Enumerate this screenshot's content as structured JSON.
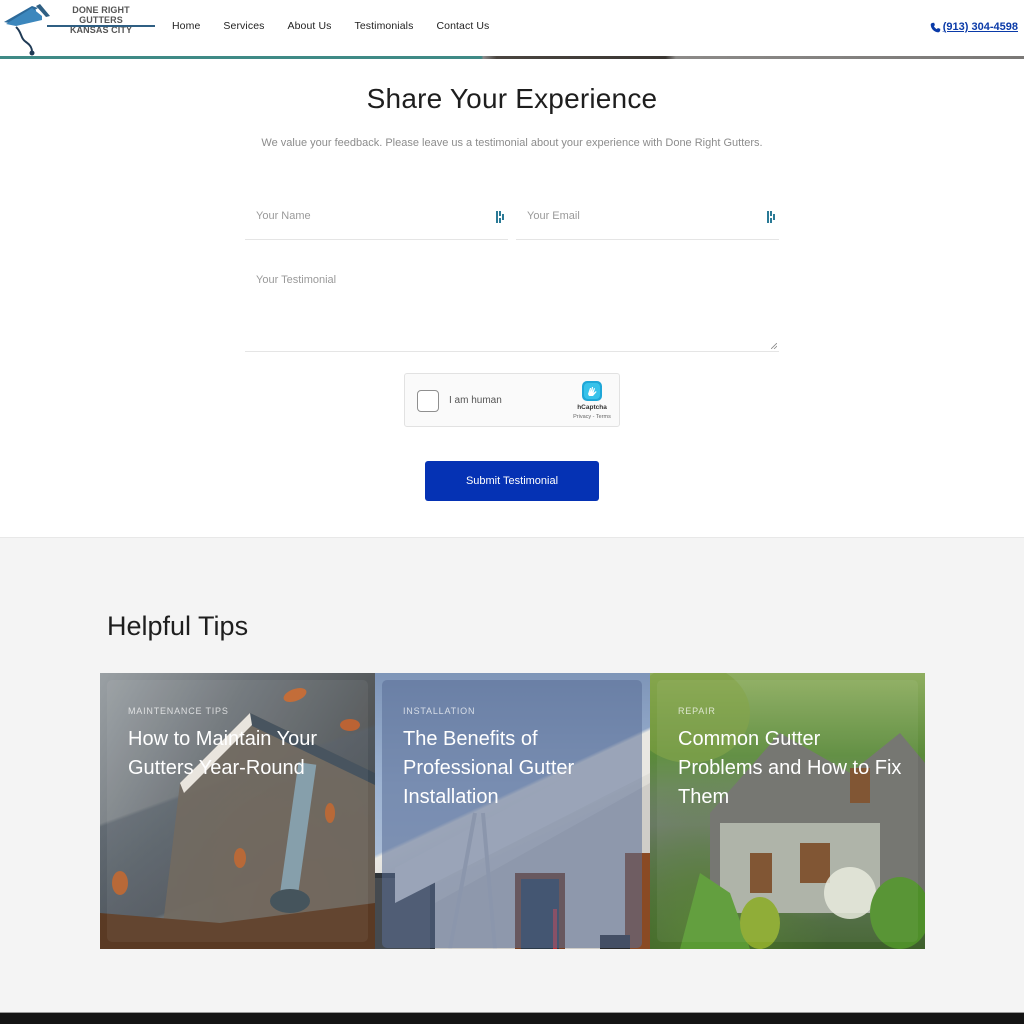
{
  "header": {
    "logo": {
      "line1": "DONE RIGHT GUTTERS",
      "line2": "KANSAS CITY"
    },
    "nav": [
      {
        "label": "Home"
      },
      {
        "label": "Services"
      },
      {
        "label": "About Us"
      },
      {
        "label": "Testimonials"
      },
      {
        "label": "Contact Us"
      }
    ],
    "phone": "(913) 304-4598",
    "phone_icon": "phone-icon"
  },
  "share": {
    "title": "Share Your Experience",
    "description": "We value your feedback. Please leave us a testimonial about your experience with Done Right Gutters.",
    "form": {
      "name_placeholder": "Your Name",
      "email_placeholder": "Your Email",
      "testimonial_placeholder": "Your Testimonial",
      "name_value": "",
      "email_value": "",
      "testimonial_value": ""
    },
    "captcha": {
      "label": "I am human",
      "brand": "hCaptcha",
      "links": "Privacy - Terms"
    },
    "submit_label": "Submit Testimonial"
  },
  "tips": {
    "title": "Helpful Tips",
    "cards": [
      {
        "category": "MAINTENANCE TIPS",
        "title": "How to Maintain Your Gutters Year-Round"
      },
      {
        "category": "INSTALLATION",
        "title": "The Benefits of Professional Gutter Installation"
      },
      {
        "category": "REPAIR",
        "title": "Common Gutter Problems and How to Fix Them"
      }
    ]
  },
  "colors": {
    "brand_blue": "#0532b4",
    "phone_blue": "#0a3aa8",
    "header_accent": "#3f8a86"
  }
}
